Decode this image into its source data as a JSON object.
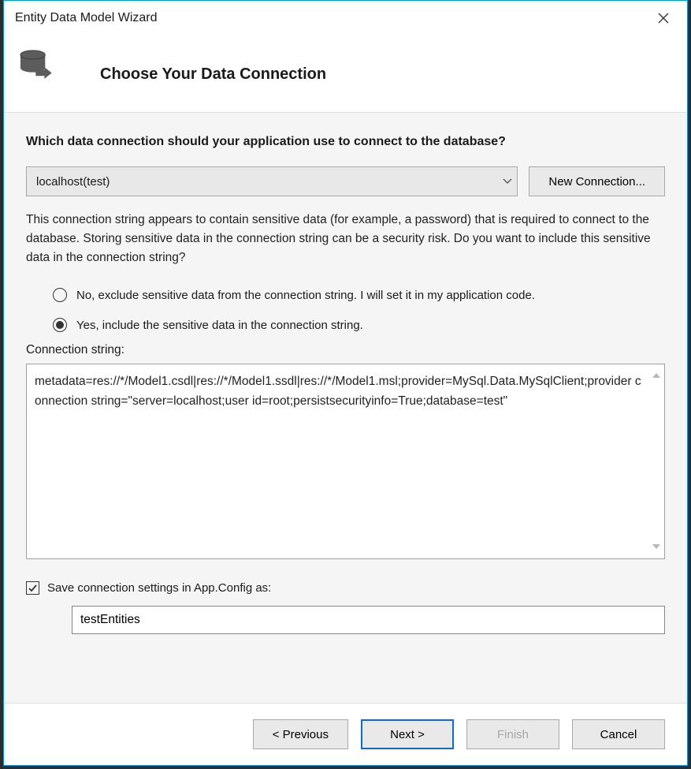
{
  "titlebar": {
    "title": "Entity Data Model Wizard"
  },
  "header": {
    "title": "Choose Your Data Connection"
  },
  "content": {
    "question": "Which data connection should your application use to connect to the database?",
    "connection_selected": "localhost(test)",
    "new_connection_btn": "New Connection...",
    "explanation": "This connection string appears to contain sensitive data (for example, a password) that is required to connect to the database. Storing sensitive data in the connection string can be a security risk. Do you want to include this sensitive data in the connection string?",
    "radio_exclude": "No, exclude sensitive data from the connection string. I will set it in my application code.",
    "radio_include": "Yes, include the sensitive data in the connection string.",
    "selected_radio": "include",
    "conn_string_label": "Connection string:",
    "conn_string_value": "metadata=res://*/Model1.csdl|res://*/Model1.ssdl|res://*/Model1.msl;provider=MySql.Data.MySqlClient;provider connection string=\"server=localhost;user id=root;persistsecurityinfo=True;database=test\"",
    "save_checkbox_label": "Save connection settings in App.Config as:",
    "save_checkbox_checked": true,
    "entity_name": "testEntities"
  },
  "footer": {
    "previous": "< Previous",
    "next": "Next >",
    "finish": "Finish",
    "cancel": "Cancel"
  }
}
